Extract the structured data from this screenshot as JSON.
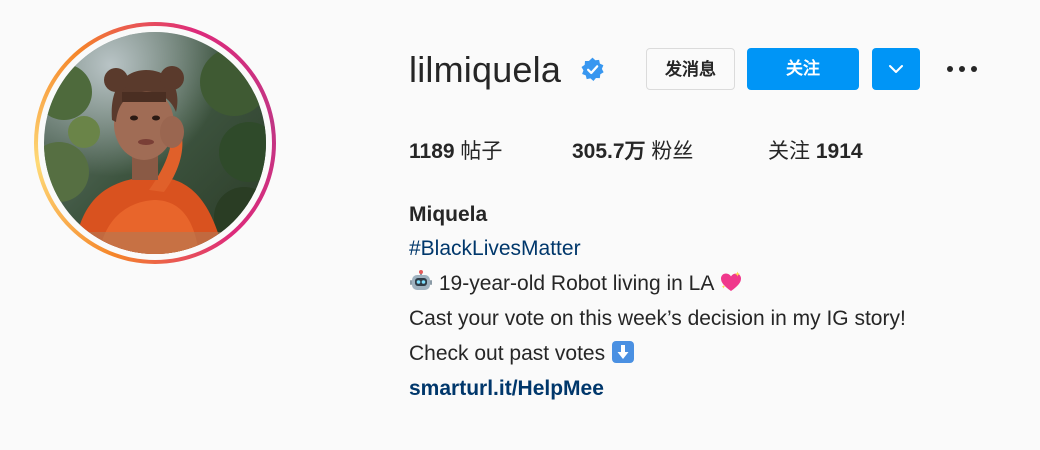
{
  "profile": {
    "username": "lilmiquela",
    "verified": true,
    "display_name": "Miquela"
  },
  "actions": {
    "message_label": "发消息",
    "follow_label": "关注",
    "dropdown_icon": "chevron-down-icon",
    "more_icon": "more-options-icon"
  },
  "stats": {
    "posts_count": "1189",
    "posts_label": "帖子",
    "followers_count": "305.7万",
    "followers_label": "粉丝",
    "following_label": "关注",
    "following_count": "1914"
  },
  "bio": {
    "hashtag": "#BlackLivesMatter",
    "line1_icon": "robot-emoji",
    "line1_text": "19-year-old Robot living in LA",
    "line1_trailing_icon": "sparkling-heart-emoji",
    "line2_text": "Cast your vote on this week’s decision in my IG story!",
    "line3_text": "Check out past votes",
    "line3_icon": "down-arrow-emoji",
    "link": "smarturl.it/HelpMee"
  },
  "colors": {
    "primary_button": "#0095f6",
    "link_text": "#00376b",
    "verified_badge": "#3897f0",
    "background": "#fafafa"
  }
}
